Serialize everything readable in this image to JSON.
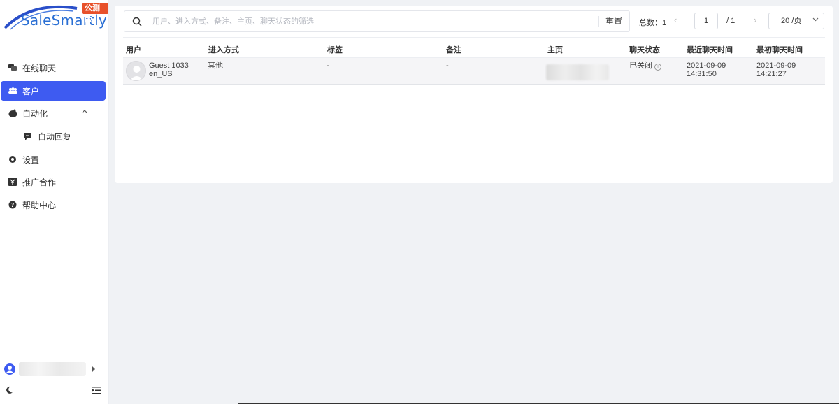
{
  "brand": {
    "name": "SaleSmartly",
    "badge": "公测版"
  },
  "sidebar": {
    "items": [
      {
        "label": "在线聊天",
        "icon": "chat-icon"
      },
      {
        "label": "客户",
        "icon": "users-icon",
        "active": true
      },
      {
        "label": "自动化",
        "icon": "robot-icon"
      },
      {
        "label": "自动回复",
        "icon": "message-icon"
      },
      {
        "label": "设置",
        "icon": "gear-icon"
      },
      {
        "label": "推广合作",
        "icon": "referral-icon"
      },
      {
        "label": "帮助中心",
        "icon": "help-icon"
      }
    ]
  },
  "toolbar": {
    "search_placeholder": "用户、进入方式、备注、主页、聊天状态的筛选",
    "reset_label": "重置",
    "total_text": "总数：1",
    "page_current": "1",
    "page_of": "/ 1",
    "page_size": "20 /页"
  },
  "table": {
    "columns": [
      "用户",
      "进入方式",
      "标签",
      "备注",
      "主页",
      "聊天状态",
      "最近聊天时间",
      "最初聊天时间"
    ],
    "rows": [
      {
        "user_name": "Guest 1033",
        "user_locale": "en_US",
        "entry": "其他",
        "tag": "-",
        "note": "-",
        "status": "已关闭",
        "last_chat_date": "2021-09-09",
        "last_chat_time": "14:31:50",
        "first_chat_date": "2021-09-09",
        "first_chat_time": "14:21:27"
      }
    ]
  },
  "colors": {
    "accent": "#3e5bf1",
    "badge": "#e8512a",
    "brand_text": "#2a6fd4"
  }
}
